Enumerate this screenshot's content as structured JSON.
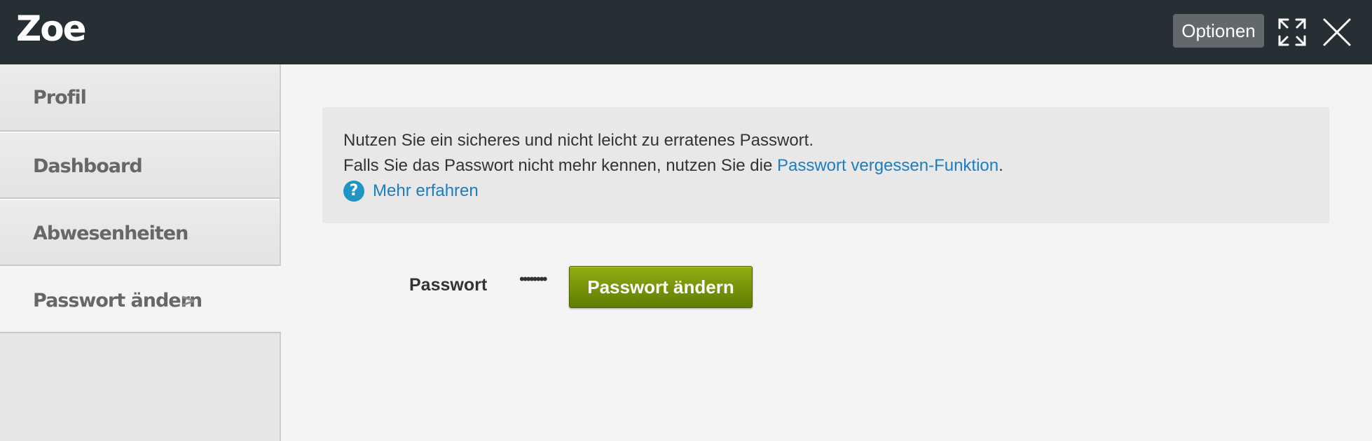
{
  "header": {
    "title": "Zoe",
    "options_label": "Optionen",
    "expand_icon": "expand-icon",
    "close_icon": "close-icon"
  },
  "sidebar": {
    "items": [
      {
        "label": "Profil",
        "active": false
      },
      {
        "label": "Dashboard",
        "active": false
      },
      {
        "label": "Abwesenheiten",
        "active": false
      },
      {
        "label": "Passwort ändern",
        "active": true,
        "chevron": ">"
      }
    ]
  },
  "info": {
    "line1": "Nutzen Sie ein sicheres und nicht leicht zu erratenes Passwort.",
    "line2_prefix": "Falls Sie das Passwort nicht mehr kennen, nutzen Sie die ",
    "line2_link": "Passwort vergessen-Funktion",
    "line2_suffix": ".",
    "help_icon": "question-circle-icon",
    "help_glyph": "?",
    "help_link": "Mehr erfahren"
  },
  "form": {
    "password_label": "Passwort",
    "password_value": "••••••••",
    "submit_label": "Passwort ändern"
  },
  "colors": {
    "header_bg": "#262f33",
    "link": "#1b7ec5",
    "button_green": "#6f8c06",
    "help_icon": "#1f95c6"
  }
}
